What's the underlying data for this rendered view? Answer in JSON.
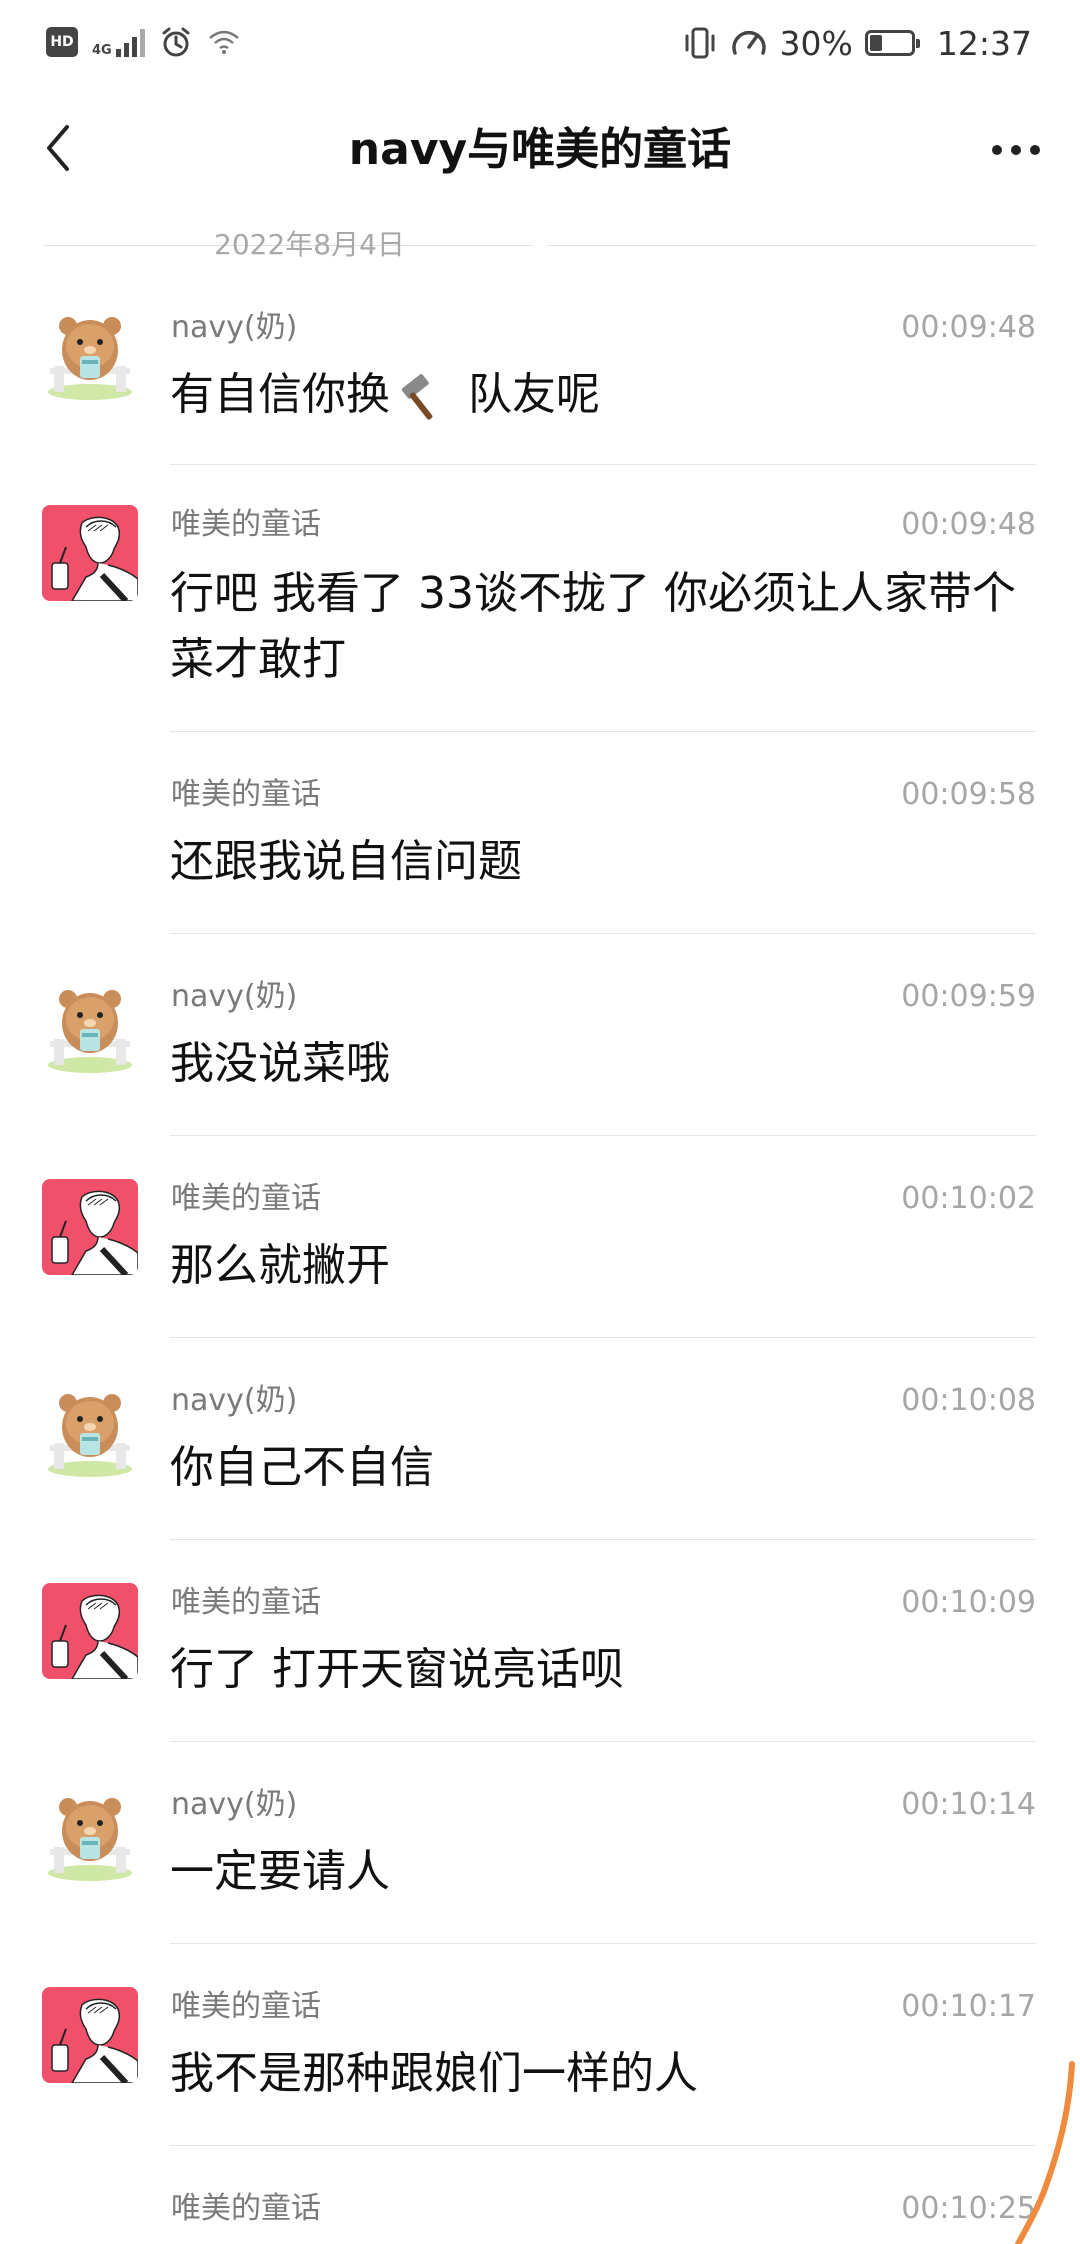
{
  "status_bar": {
    "hd": "HD",
    "network": "4G",
    "speed_icon": "speedometer-icon",
    "battery_percent": "30%",
    "battery_level": 0.3,
    "time": "12:37"
  },
  "header": {
    "title": "navy与唯美的童话",
    "back_icon": "chevron-left-icon",
    "more_icon": "more-dots-icon"
  },
  "date_divider": "2022年8月4日",
  "messages": [
    {
      "sender": "navy(奶)",
      "time": "00:09:48",
      "text_before": "有自信你换",
      "emoji": "hammer-emoji",
      "text_after": " 队友呢",
      "avatar": "bear-avatar"
    },
    {
      "sender": "唯美的童话",
      "time": "00:09:48",
      "text": "行吧 我看了 33谈不拢了 你必须让人家带个菜才敢打",
      "avatar": "sketch-avatar"
    },
    {
      "sender": "唯美的童话",
      "time": "00:09:58",
      "text": "还跟我说自信问题",
      "avatar": ""
    },
    {
      "sender": "navy(奶)",
      "time": "00:09:59",
      "text": "我没说菜哦",
      "avatar": "bear-avatar"
    },
    {
      "sender": "唯美的童话",
      "time": "00:10:02",
      "text": "那么就撇开",
      "avatar": "sketch-avatar"
    },
    {
      "sender": "navy(奶)",
      "time": "00:10:08",
      "text": "你自己不自信",
      "avatar": "bear-avatar"
    },
    {
      "sender": "唯美的童话",
      "time": "00:10:09",
      "text": "行了 打开天窗说亮话呗",
      "avatar": "sketch-avatar"
    },
    {
      "sender": "navy(奶)",
      "time": "00:10:14",
      "text": "一定要请人",
      "avatar": "bear-avatar"
    },
    {
      "sender": "唯美的童话",
      "time": "00:10:17",
      "text": "我不是那种跟娘们一样的人",
      "avatar": "sketch-avatar"
    },
    {
      "sender": "唯美的童话",
      "time": "00:10:25",
      "text": "",
      "avatar": ""
    }
  ],
  "colors": {
    "sketch_avatar_bg": "#f0506a",
    "bear_body": "#c98d5a",
    "annotation_stroke": "#f08a3c"
  }
}
